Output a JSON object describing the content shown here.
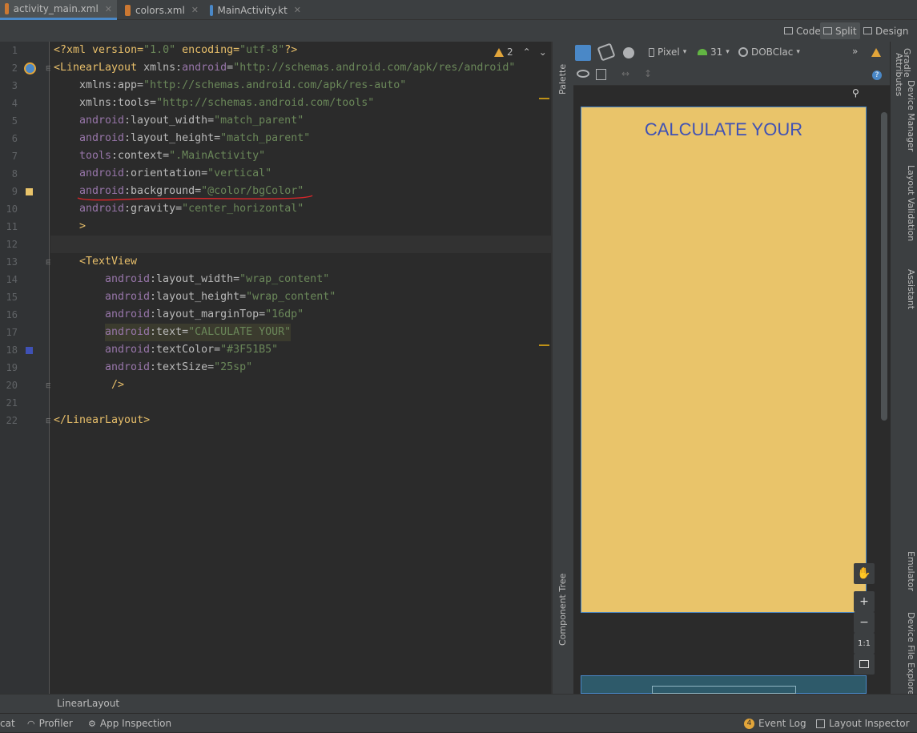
{
  "tabs": [
    {
      "label": "activity_main.xml",
      "type": "xml",
      "active": true
    },
    {
      "label": "colors.xml",
      "type": "xml",
      "active": false
    },
    {
      "label": "MainActivity.kt",
      "type": "kt",
      "active": false
    }
  ],
  "view_modes": {
    "code": "Code",
    "split": "Split",
    "design": "Design",
    "selected": "Split"
  },
  "inspection": {
    "warning_count": "2"
  },
  "line_numbers": [
    "1",
    "2",
    "3",
    "4",
    "5",
    "6",
    "7",
    "8",
    "9",
    "10",
    "11",
    "12",
    "13",
    "14",
    "15",
    "16",
    "17",
    "18",
    "19",
    "20",
    "21",
    "22"
  ],
  "code": {
    "l1": {
      "p1": "<?xml version=",
      "p2": "\"1.0\"",
      "p3": " encoding=",
      "p4": "\"utf-8\"",
      "p5": "?>"
    },
    "l2": {
      "tag": "<LinearLayout ",
      "ns": "xmlns:",
      "attr": "android",
      "eq": "=",
      "val": "\"http://schemas.android.com/apk/res/android\""
    },
    "l3": {
      "attr": "xmlns:app=",
      "val": "\"http://schemas.android.com/apk/res-auto\""
    },
    "l4": {
      "attr": "xmlns:tools=",
      "val": "\"http://schemas.android.com/tools\""
    },
    "l5": {
      "ns": "android",
      "attr": ":layout_width=",
      "val": "\"match_parent\""
    },
    "l6": {
      "ns": "android",
      "attr": ":layout_height=",
      "val": "\"match_parent\""
    },
    "l7": {
      "ns": "tools",
      "attr": ":context=",
      "val": "\".MainActivity\""
    },
    "l8": {
      "ns": "android",
      "attr": ":orientation=",
      "val": "\"vertical\""
    },
    "l9": {
      "ns": "android",
      "attr": ":background=",
      "val": "\"@color/bgColor\""
    },
    "l10": {
      "ns": "android",
      "attr": ":gravity=",
      "val": "\"center_horizontal\""
    },
    "l11": {
      "text": ">"
    },
    "l13": {
      "tag": "<TextView"
    },
    "l14": {
      "ns": "android",
      "attr": ":layout_width=",
      "val": "\"wrap_content\""
    },
    "l15": {
      "ns": "android",
      "attr": ":layout_height=",
      "val": "\"wrap_content\""
    },
    "l16": {
      "ns": "android",
      "attr": ":layout_marginTop=",
      "val": "\"16dp\""
    },
    "l17": {
      "ns": "android",
      "attr": ":text=",
      "val": "\"CALCULATE YOUR\""
    },
    "l18": {
      "ns": "android",
      "attr": ":textColor=",
      "val": "\"#3F51B5\""
    },
    "l19": {
      "ns": "android",
      "attr": ":textSize=",
      "val": "\"25sp\""
    },
    "l20": {
      "text": "/>"
    },
    "l22": {
      "tag": "</LinearLayout>"
    }
  },
  "design_toolbar": {
    "device": "Pixel",
    "api": "31",
    "theme": "DOBClac"
  },
  "side_panels": {
    "palette": "Palette",
    "component_tree": "Component Tree",
    "attributes": "Attributes",
    "gradle": "Gradle",
    "device_manager": "Device Manager",
    "layout_validation": "Layout Validation",
    "assistant": "Assistant",
    "emulator": "Emulator",
    "device_file_explorer": "Device File Explorer"
  },
  "preview": {
    "text": "CALCULATE YOUR",
    "bg_color": "#E9C46A",
    "text_color": "#3F51B5"
  },
  "zoom": {
    "plus": "+",
    "minus": "−",
    "one_to_one": "1:1"
  },
  "breadcrumb": {
    "label": "LinearLayout"
  },
  "status_bar": {
    "logcat": "cat",
    "profiler": "Profiler",
    "app_inspection": "App Inspection",
    "event_count": "4",
    "event_log": "Event Log",
    "layout_inspector": "Layout Inspector"
  },
  "gutter_colors": {
    "bg_color_swatch": "#E9C46A",
    "text_color_swatch": "#3F51B5"
  }
}
